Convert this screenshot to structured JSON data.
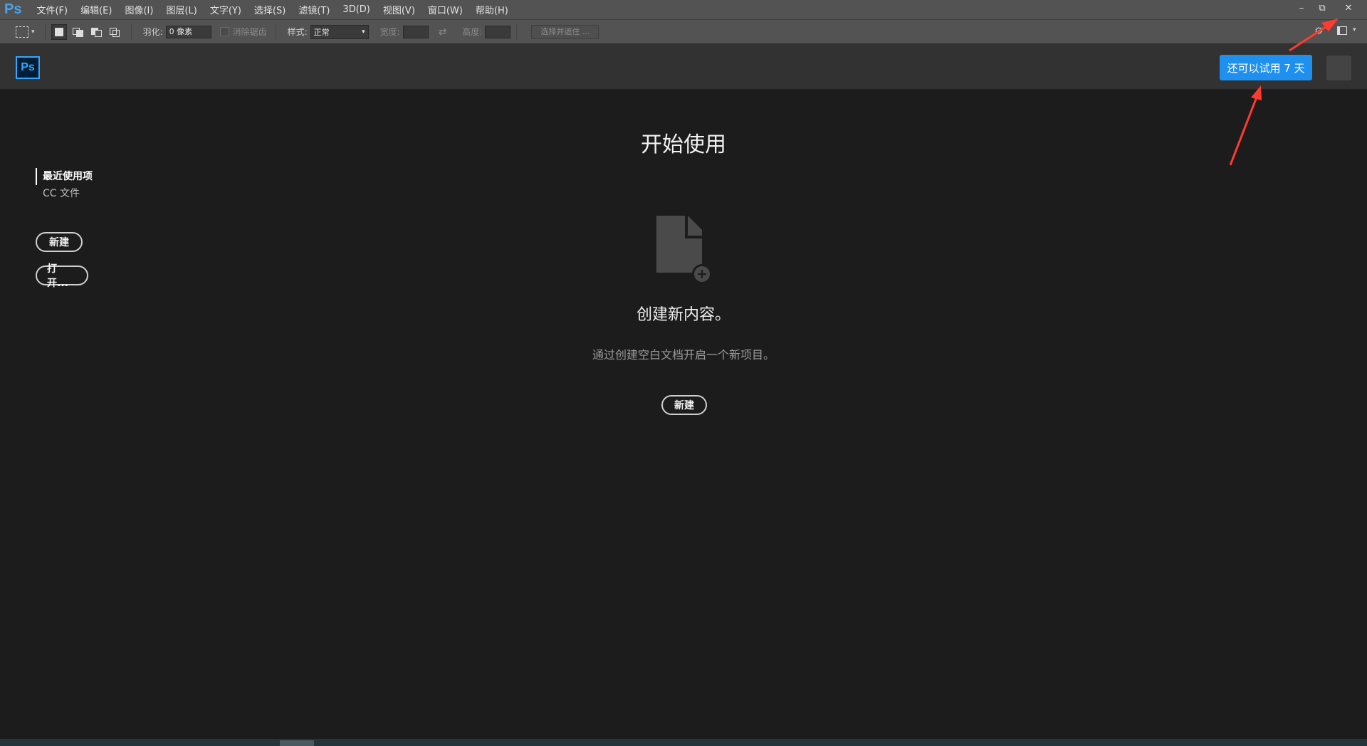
{
  "menubar": {
    "app_icon": "Ps",
    "items": [
      "文件(F)",
      "编辑(E)",
      "图像(I)",
      "图层(L)",
      "文字(Y)",
      "选择(S)",
      "滤镜(T)",
      "3D(D)",
      "视图(V)",
      "窗口(W)",
      "帮助(H)"
    ],
    "window_controls": {
      "minimize": "–",
      "restore": "⧉",
      "close": "✕"
    }
  },
  "optionsbar": {
    "feather_label": "羽化:",
    "feather_value": "0 像素",
    "antialias_label": "消除锯齿",
    "style_label": "样式:",
    "style_value": "正常",
    "width_label": "宽度:",
    "height_label": "高度:",
    "mask_button": "选择并遮住 ..."
  },
  "header": {
    "logo": "Ps",
    "trial_button": "还可以试用 7 天"
  },
  "leftnav": {
    "items": [
      "最近使用项",
      "CC 文件"
    ],
    "new_button": "新建",
    "open_button": "打开..."
  },
  "main": {
    "title": "开始使用",
    "cta_title": "创建新内容。",
    "cta_description": "通过创建空白文档开启一个新项目。",
    "cta_button": "新建"
  },
  "colors": {
    "accent": "#1e90f0",
    "ps_blue": "#31a8ff",
    "annotation": "#ff3b30"
  }
}
